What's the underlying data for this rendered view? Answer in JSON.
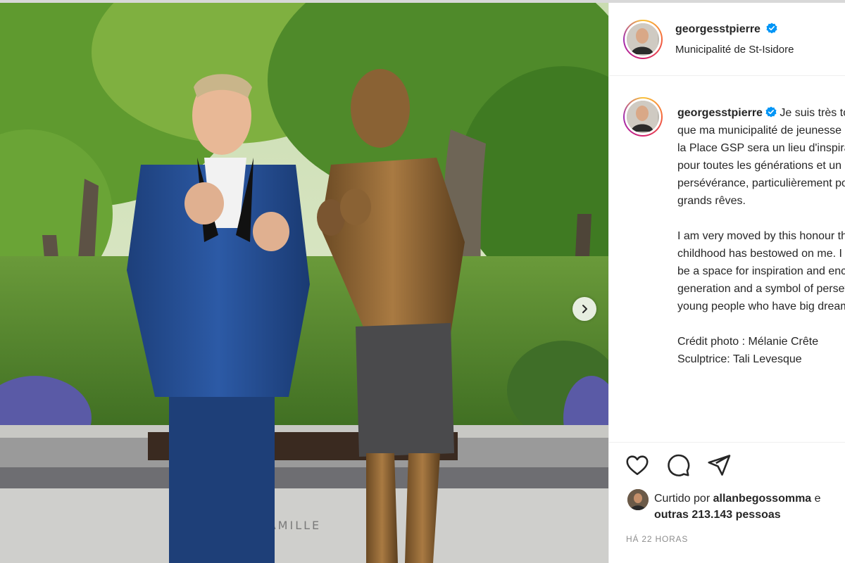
{
  "post": {
    "username": "georgesstpierre",
    "location": "Municipalité de St-Isidore",
    "verified_icon": "verified-badge-icon",
    "accent_color": "#0095f6"
  },
  "photo": {
    "description_icon": "photo",
    "plaque_text": "FAMILLE",
    "next_icon": "chevron-right-icon"
  },
  "caption": {
    "username": "georgesstpierre",
    "text": " Je suis très touché par cet honneur que ma municipalité de jeunesse m'accorde. J'espère que la Place GSP sera un lieu d'inspiration et de rencontres pour toutes les générations et un symbole de persévérance, particulièrement pour les jeunes qui ont de grands rêves.\n\nI am very moved by this honour that the municipality of my childhood has bestowed on me. I hope that Place GSP will be a space for inspiration and encounters for every generation and a symbol of perseverance, especially for young people who have big dreams.\n\nCrédit photo : Mélanie Crête\nSculptrice: Tali Levesque"
  },
  "actions": {
    "like_icon": "heart-icon",
    "comment_icon": "comment-icon",
    "share_icon": "share-icon"
  },
  "likes": {
    "prefix": "Curtido por ",
    "liker": "allanbegossomma",
    "and": " e",
    "others_label": "outras 213.143 pessoas"
  },
  "timestamp": "HÁ 22 HORAS"
}
